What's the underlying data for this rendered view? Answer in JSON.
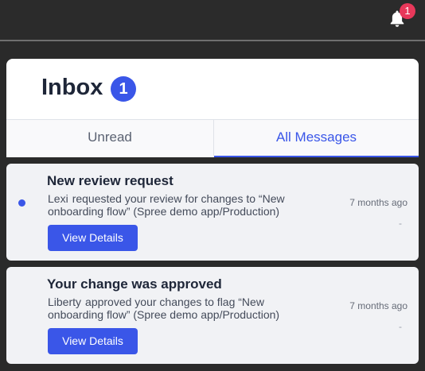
{
  "header": {
    "notification_count": "1"
  },
  "inbox": {
    "title": "Inbox",
    "count": "1",
    "tabs": [
      {
        "label": "Unread"
      },
      {
        "label": "All Messages"
      }
    ]
  },
  "messages": [
    {
      "title": "New review request",
      "actor": "Lexi",
      "text": "requested your review for changes to “New onboarding flow” (Spree demo app/Production)",
      "time": "7 months ago",
      "extra": "-",
      "button": "View Details"
    },
    {
      "title": "Your change was approved",
      "actor": "Liberty",
      "text": "approved your changes to flag “New onboarding flow” (Spree demo app/Production)",
      "time": "7 months ago",
      "extra": "-",
      "button": "View Details"
    }
  ],
  "colors": {
    "accent": "#3a56e8",
    "badge": "#e8385a"
  },
  "icons": {
    "notifications": "bell-icon"
  }
}
